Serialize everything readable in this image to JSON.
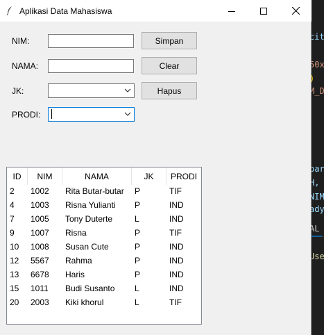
{
  "window": {
    "title": "Aplikasi Data Mahasiswa"
  },
  "form": {
    "nim_label": "NIM:",
    "nama_label": "NAMA:",
    "jk_label": "JK:",
    "prodi_label": "PRODI:",
    "nim_value": "",
    "nama_value": "",
    "jk_value": "",
    "prodi_value": ""
  },
  "buttons": {
    "simpan": "Simpan",
    "clear": "Clear",
    "hapus": "Hapus"
  },
  "table": {
    "columns": [
      "ID",
      "NIM",
      "NAMA",
      "JK",
      "PRODI"
    ],
    "rows": [
      {
        "id": "2",
        "nim": "1002",
        "nama": "Rita Butar-butar",
        "jk": "P",
        "prodi": "TIF"
      },
      {
        "id": "4",
        "nim": "1003",
        "nama": "Risna Yulianti",
        "jk": "P",
        "prodi": "IND"
      },
      {
        "id": "7",
        "nim": "1005",
        "nama": "Tony Duterte",
        "jk": "L",
        "prodi": "IND"
      },
      {
        "id": "9",
        "nim": "1007",
        "nama": "Risna",
        "jk": "P",
        "prodi": "TIF"
      },
      {
        "id": "10",
        "nim": "1008",
        "nama": "Susan Cute",
        "jk": "P",
        "prodi": "IND"
      },
      {
        "id": "12",
        "nim": "5567",
        "nama": "Rahma",
        "jk": "P",
        "prodi": "IND"
      },
      {
        "id": "13",
        "nim": "6678",
        "nama": "Haris",
        "jk": "P",
        "prodi": "IND"
      },
      {
        "id": "15",
        "nim": "1011",
        "nama": "Budi Susanto",
        "jk": "L",
        "prodi": "IND"
      },
      {
        "id": "20",
        "nim": "2003",
        "nama": "Kiki khorul",
        "jk": "L",
        "prodi": "TIF"
      }
    ]
  },
  "background_editor": {
    "lines": [
      {
        "text": "cit",
        "color": "#9cdcfe"
      },
      {
        "text": "50x",
        "color": "#ce9178"
      },
      {
        "text": ")",
        "color": "#ffd700"
      },
      {
        "text": "M_D",
        "color": "#ce9178"
      },
      {
        "text": "par",
        "color": "#9cdcfe"
      },
      {
        "text": "H,",
        "color": "#9cdcfe"
      },
      {
        "text": "NIM",
        "color": "#9cdcfe"
      },
      {
        "text": "ady",
        "color": "#9cdcfe"
      },
      {
        "text": "AL",
        "color": "#cccccc"
      },
      {
        "text": "Use",
        "color": "#dcdcaa"
      }
    ]
  },
  "colors": {
    "window_bg": "#f0f0f0",
    "focus_border": "#0078d7",
    "editor_bg": "#1e1e1e"
  }
}
